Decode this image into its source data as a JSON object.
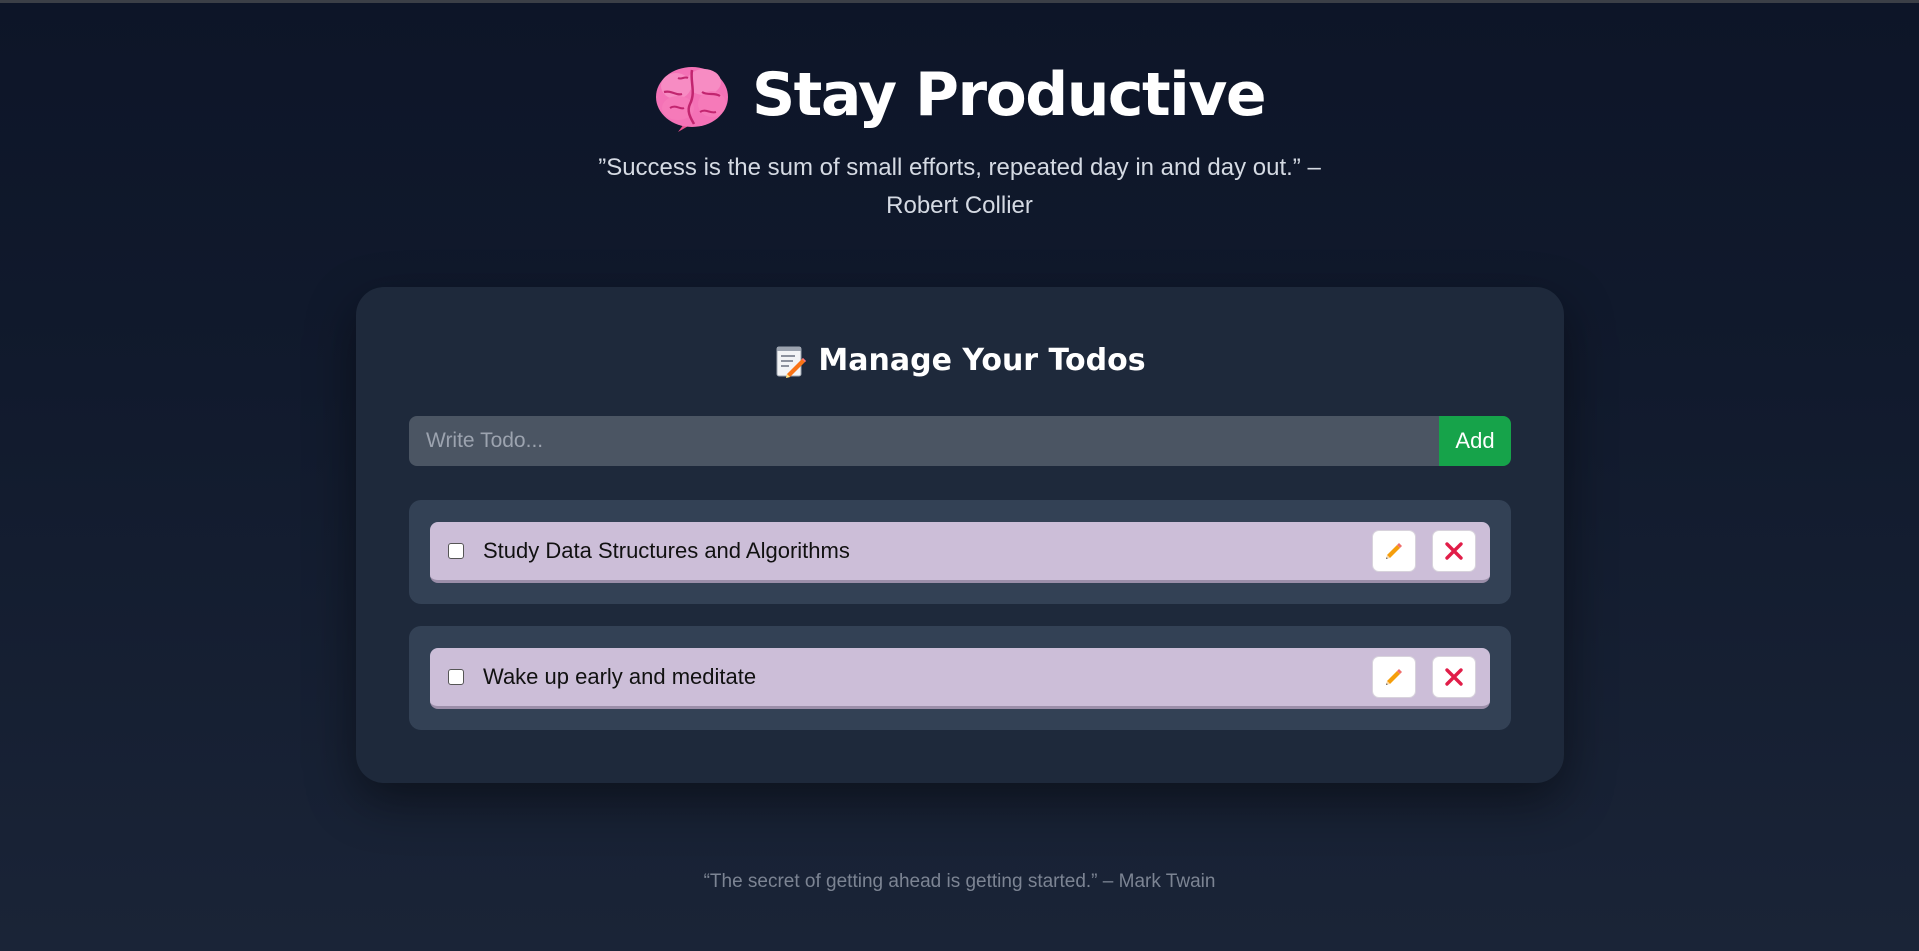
{
  "header": {
    "icon": "brain-icon",
    "title": "Stay Productive",
    "quote": "”Success is the sum of small efforts, repeated day in and day out.” – Robert Collier"
  },
  "todos_card": {
    "icon": "memo-icon",
    "title": "Manage Your Todos",
    "input": {
      "value": "",
      "placeholder": "Write Todo..."
    },
    "add_label": "Add",
    "items": [
      {
        "text": "Study Data Structures and Algorithms",
        "completed": false,
        "edit_icon": "pencil-icon",
        "delete_icon": "close-icon"
      },
      {
        "text": "Wake up early and meditate",
        "completed": false,
        "edit_icon": "pencil-icon",
        "delete_icon": "close-icon"
      }
    ]
  },
  "footer": {
    "quote": "“The secret of getting ahead is getting started.” – Mark Twain"
  },
  "colors": {
    "background": "#0f172a",
    "card": "#1e293b",
    "item_wrapper": "#334155",
    "item": "#ccbed8",
    "add_button": "#16a34a",
    "delete_icon": "#e11d48",
    "edit_icon": "#f59e0b"
  }
}
